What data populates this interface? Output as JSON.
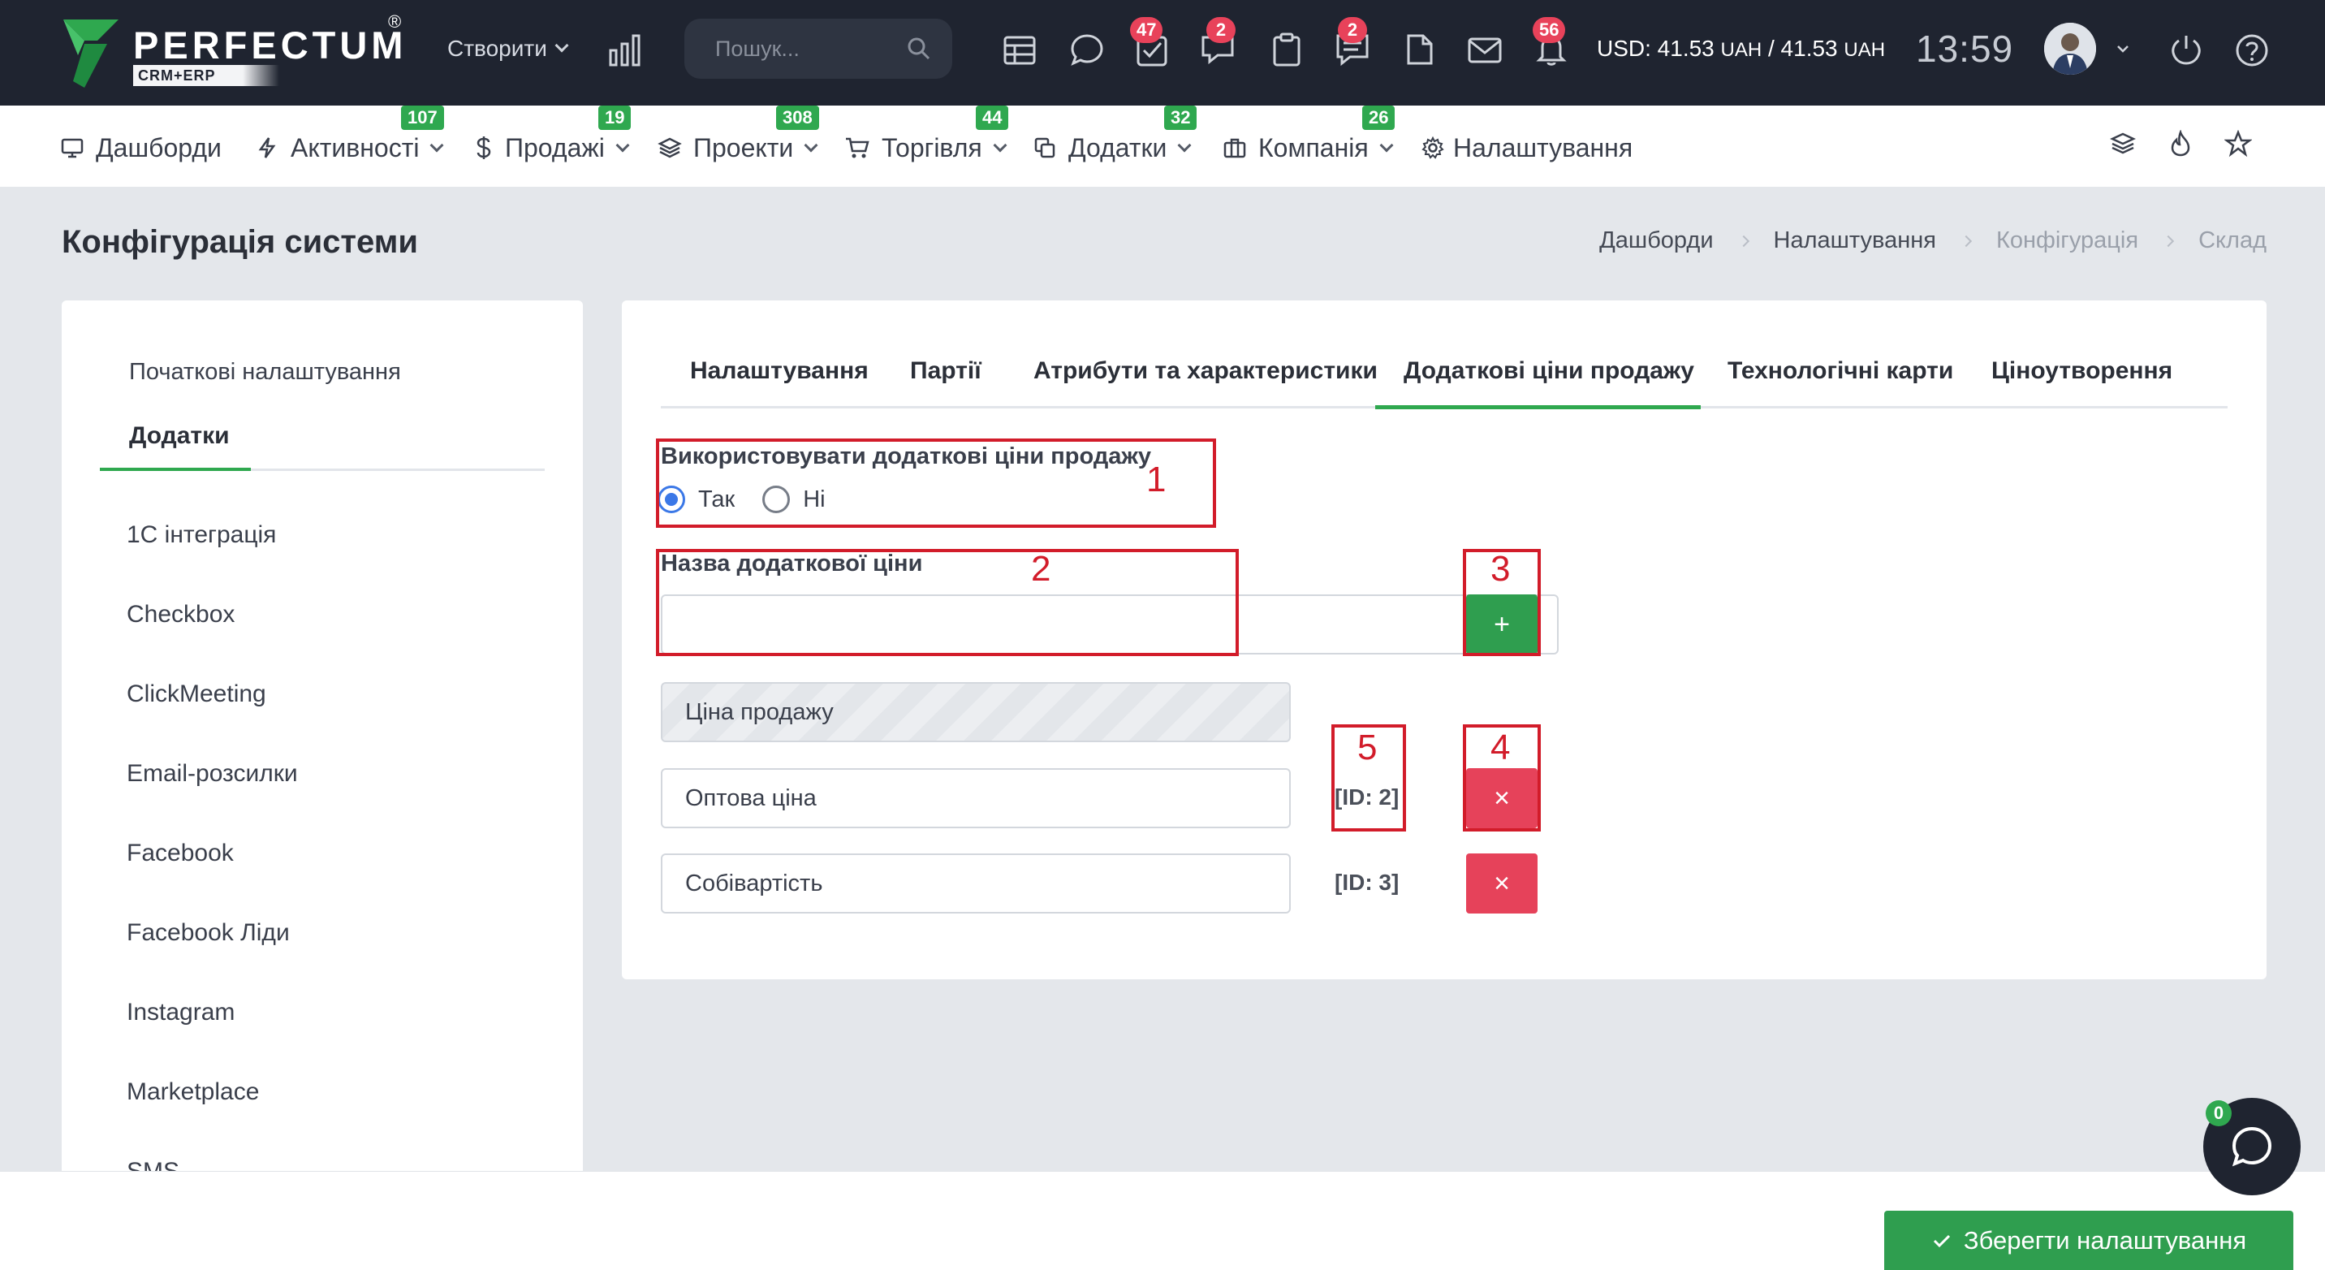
{
  "topbar": {
    "logo_text": "PERFECTUM",
    "logo_reg": "®",
    "logo_sub": "CRM+ERP",
    "create_label": "Створити",
    "search": {
      "placeholder": "Пошук..."
    },
    "badges": {
      "tasks": "47",
      "chat": "2",
      "notes": "2",
      "notifications": "56"
    },
    "currency_label": "USD: 41.53",
    "currency_unit1": "UAH",
    "currency_mid": " / 41.53 ",
    "currency_unit2": "UAH",
    "clock": "13:59"
  },
  "nav": {
    "items": [
      {
        "label": "Дашборди",
        "badge": ""
      },
      {
        "label": "Активності",
        "badge": "107"
      },
      {
        "label": "Продажі",
        "badge": "19"
      },
      {
        "label": "Проекти",
        "badge": "308"
      },
      {
        "label": "Торгівля",
        "badge": "44"
      },
      {
        "label": "Додатки",
        "badge": "32"
      },
      {
        "label": "Компанія",
        "badge": "26"
      },
      {
        "label": "Налаштування",
        "badge": ""
      }
    ]
  },
  "page": {
    "title": "Конфігурація системи",
    "breadcrumb": [
      "Дашборди",
      "Налаштування",
      "Конфігурація",
      "Склад"
    ]
  },
  "left_panel": {
    "tab_initial": "Початкові налаштування",
    "tab_addons": "Додатки",
    "items": [
      "1С інтеграція",
      "Checkbox",
      "ClickMeeting",
      "Email-розсилки",
      "Facebook",
      "Facebook Ліди",
      "Instagram",
      "Marketplace",
      "SMS"
    ]
  },
  "main": {
    "tabs": [
      "Налаштування",
      "Партії",
      "Атрибути та характеристики",
      "Додаткові ціни продажу",
      "Технологічні карти",
      "Ціноутворення"
    ],
    "use_extra_prices_label": "Використовувати додаткові ціни продажу",
    "radio_yes": "Так",
    "radio_no": "Ні",
    "extra_price_name_label": "Назва додаткової ціни",
    "extra_price_name_value": "",
    "add_button": "+",
    "prices": [
      {
        "name": "Ціна продажу",
        "id": "",
        "disabled": true
      },
      {
        "name": "Оптова ціна",
        "id": "[ID: 2]",
        "disabled": false
      },
      {
        "name": "Собівартість",
        "id": "[ID: 3]",
        "disabled": false
      }
    ],
    "delete_button": "×"
  },
  "annotations": [
    "1",
    "2",
    "3",
    "4",
    "5"
  ],
  "footer": {
    "save_label": "Зберегти налаштування",
    "chat_badge": "0"
  },
  "colors": {
    "topbar_bg": "#1f2430",
    "accent_green": "#2fa84f",
    "danger": "#e6425a",
    "annotation_red": "#d21c2a",
    "radio_blue": "#3b78e7"
  }
}
